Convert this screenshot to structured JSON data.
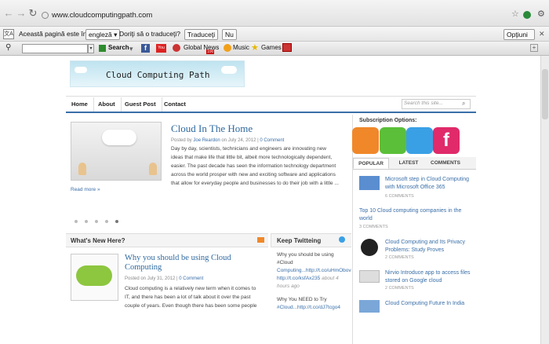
{
  "browser": {
    "url": "www.cloudcomputingpath.com"
  },
  "translate": {
    "text1": "Această pagină este în",
    "language": "engleză",
    "text2": "Doriţi să o traduceţi?",
    "translate_btn": "Traduceţi",
    "no_btn": "Nu",
    "options_btn": "Opţiuni"
  },
  "toolbar": {
    "search_label": "Search",
    "items": [
      "Global News",
      "Music",
      "Games"
    ],
    "badge": "100"
  },
  "site": {
    "logo_text": "Cloud Computing Path",
    "nav": [
      "Home",
      "About",
      "Guest Post",
      "Contact"
    ],
    "search_placeholder": "Search this site...",
    "featured": {
      "title": "Cloud In The Home",
      "meta_prefix": "Posted by ",
      "author": "Joe Reardon",
      "meta_mid": " on July 24, 2012 | ",
      "comments": "0 Comment",
      "lines": [
        "Day by day, scientists, technicians and engineers are innovating new",
        "ideas that make life that little bit, albeit more technologically dependent,",
        "easier. The past decade has seen the information technology department",
        "across the world prosper with new and exciting software and applications",
        "that allow for everyday people and businesses to do their job with a little ..."
      ],
      "more": "Read more »"
    },
    "whats_new": {
      "heading": "What's New Here?",
      "post_title_1": "Why you should be using Cloud",
      "post_title_2": "Computing",
      "meta_prefix": "Posted on July 31, 2012 | ",
      "comments": "0 Comment",
      "lines": [
        "Cloud computing is a relatively new term when it comes to",
        "IT, and there has been a lot of talk about it over the past",
        "couple of years. Even though there has been some people"
      ]
    },
    "twitter": {
      "heading": "Keep Twitteing",
      "t1_lines": [
        "Why you should be using",
        "#Cloud"
      ],
      "t1_link1": "Computing...http://t.co/uHmObov",
      "t1_link2": "http://t.co/ksfAx235",
      "t1_ago": " about 4",
      "t1_ago2": "hours ago",
      "t2_lines": [
        "Why You NEED to Try",
        "#Cloud...http://t.co/dJ7tcgo4"
      ]
    },
    "sidebar": {
      "subscription": "Subscription Options:",
      "tabs": [
        "POPULAR",
        "LATEST",
        "COMMENTS"
      ],
      "popular": [
        {
          "lines": [
            "Microsoft step in Cloud Computing",
            "with Microsoft Office 365"
          ],
          "comments": "6 COMMENTS"
        },
        {
          "lines": [
            "Top 10 Cloud computing companies in the",
            "world"
          ],
          "comments": "3 COMMENTS"
        },
        {
          "lines": [
            "Cloud Computing and Its Privacy",
            "Problems: Study Proves"
          ],
          "comments": "2 COMMENTS"
        },
        {
          "lines": [
            "Nirvio Introduce app to access files",
            "stored on Google cloud"
          ],
          "comments": "2 COMMENTS"
        },
        {
          "lines": [
            "Cloud Computing Future In India"
          ],
          "comments": ""
        }
      ]
    }
  },
  "colors": {
    "rss": "#f0882a",
    "email": "#5bbf3a",
    "twitter": "#3aa0e6",
    "facebook": "#e02a6a",
    "link": "#3a6fa8",
    "accent": "#2f6aa0"
  }
}
